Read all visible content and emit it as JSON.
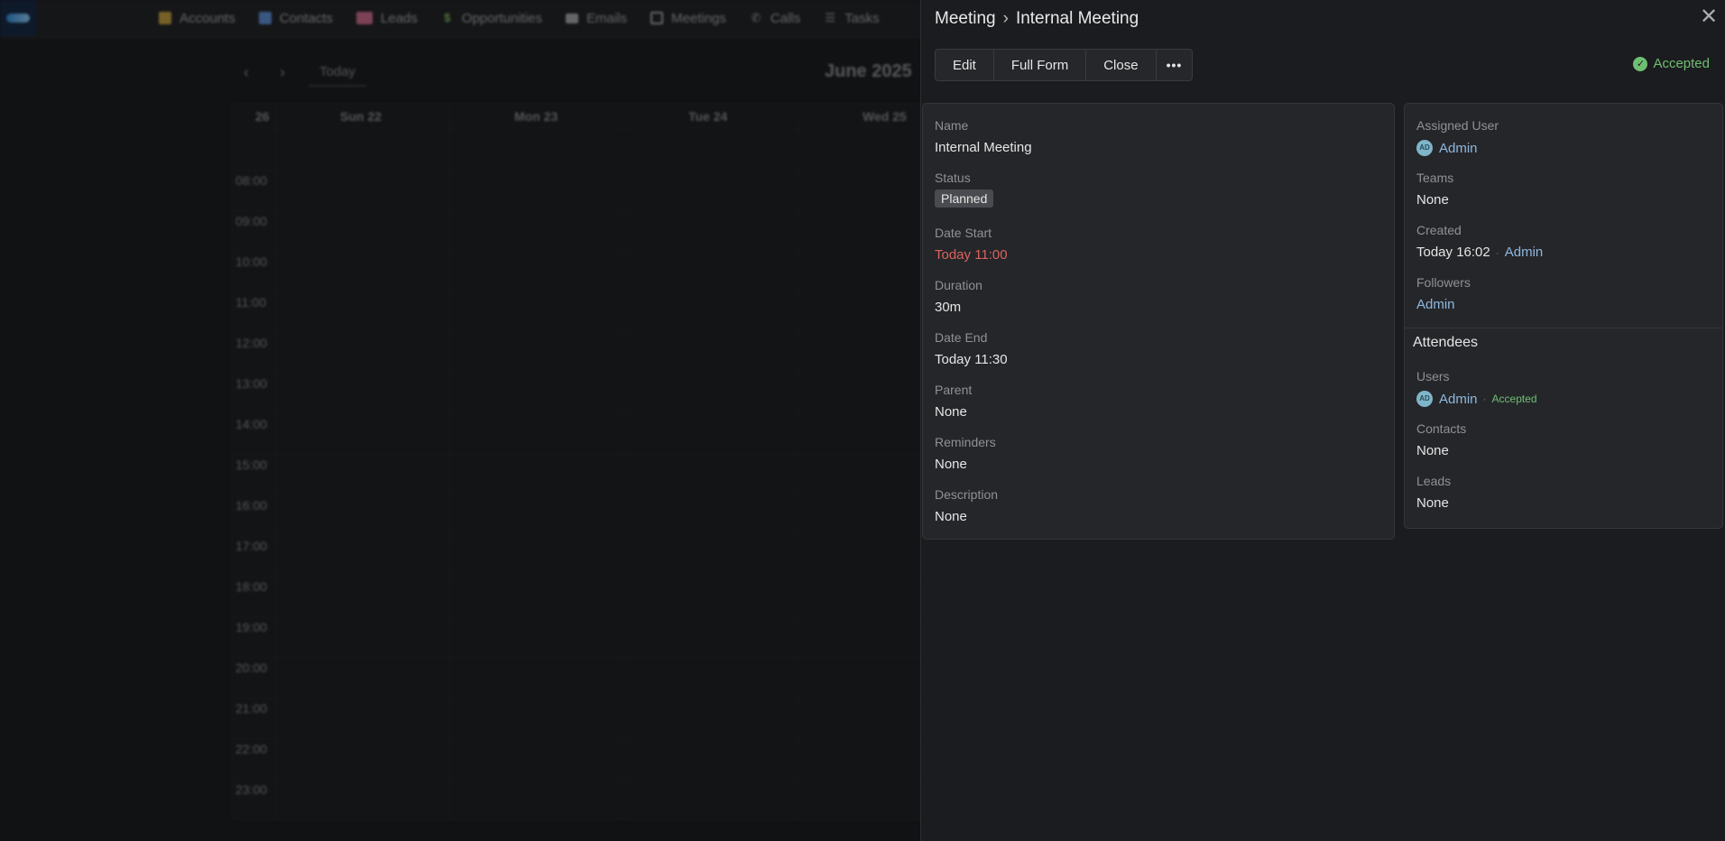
{
  "nav": {
    "items": [
      {
        "label": "Accounts",
        "icon": "building-icon",
        "color": "#c9a13a"
      },
      {
        "label": "Contacts",
        "icon": "contact-card-icon",
        "color": "#5b8fd6"
      },
      {
        "label": "Leads",
        "icon": "id-card-icon",
        "color": "#d06a8c"
      },
      {
        "label": "Opportunities",
        "icon": "dollar-icon",
        "color": "#7fbf5a"
      },
      {
        "label": "Emails",
        "icon": "envelope-icon",
        "color": "#a9abb0"
      },
      {
        "label": "Meetings",
        "icon": "calendar-check-icon",
        "color": "#a9abb0"
      },
      {
        "label": "Calls",
        "icon": "phone-icon",
        "color": "#a9abb0"
      },
      {
        "label": "Tasks",
        "icon": "checklist-icon",
        "color": "#a9abb0"
      }
    ]
  },
  "calendar": {
    "today_label": "Today",
    "title": "June 2025",
    "week_label": "26",
    "days": [
      "Sun 22",
      "Mon 23",
      "Tue 24",
      "Wed 25"
    ],
    "hours": [
      "08:00",
      "09:00",
      "10:00",
      "11:00",
      "12:00",
      "13:00",
      "14:00",
      "15:00",
      "16:00",
      "17:00",
      "18:00",
      "19:00",
      "20:00",
      "21:00",
      "22:00",
      "23:00"
    ]
  },
  "panel": {
    "entity": "Meeting",
    "separator": "›",
    "record_name": "Internal Meeting",
    "buttons": {
      "edit": "Edit",
      "full_form": "Full Form",
      "close": "Close",
      "more": "•••"
    },
    "acceptance_status": "Accepted",
    "accent_color": "#6fbf73",
    "fields": {
      "name": {
        "label": "Name",
        "value": "Internal Meeting"
      },
      "status": {
        "label": "Status",
        "value": "Planned"
      },
      "date_start": {
        "label": "Date Start",
        "value": "Today 11:00"
      },
      "duration": {
        "label": "Duration",
        "value": "30m"
      },
      "date_end": {
        "label": "Date End",
        "value": "Today 11:30"
      },
      "parent": {
        "label": "Parent",
        "value": "None"
      },
      "reminders": {
        "label": "Reminders",
        "value": "None"
      },
      "description": {
        "label": "Description",
        "value": "None"
      }
    },
    "side": {
      "assigned_user": {
        "label": "Assigned User",
        "avatar": "AD",
        "value": "Admin"
      },
      "teams": {
        "label": "Teams",
        "value": "None"
      },
      "created": {
        "label": "Created",
        "time": "Today 16:02",
        "by": "Admin"
      },
      "followers": {
        "label": "Followers",
        "value": "Admin"
      },
      "attendees_title": "Attendees",
      "users": {
        "label": "Users",
        "avatar": "AD",
        "value": "Admin",
        "status": "Accepted"
      },
      "contacts": {
        "label": "Contacts",
        "value": "None"
      },
      "leads": {
        "label": "Leads",
        "value": "None"
      }
    }
  }
}
